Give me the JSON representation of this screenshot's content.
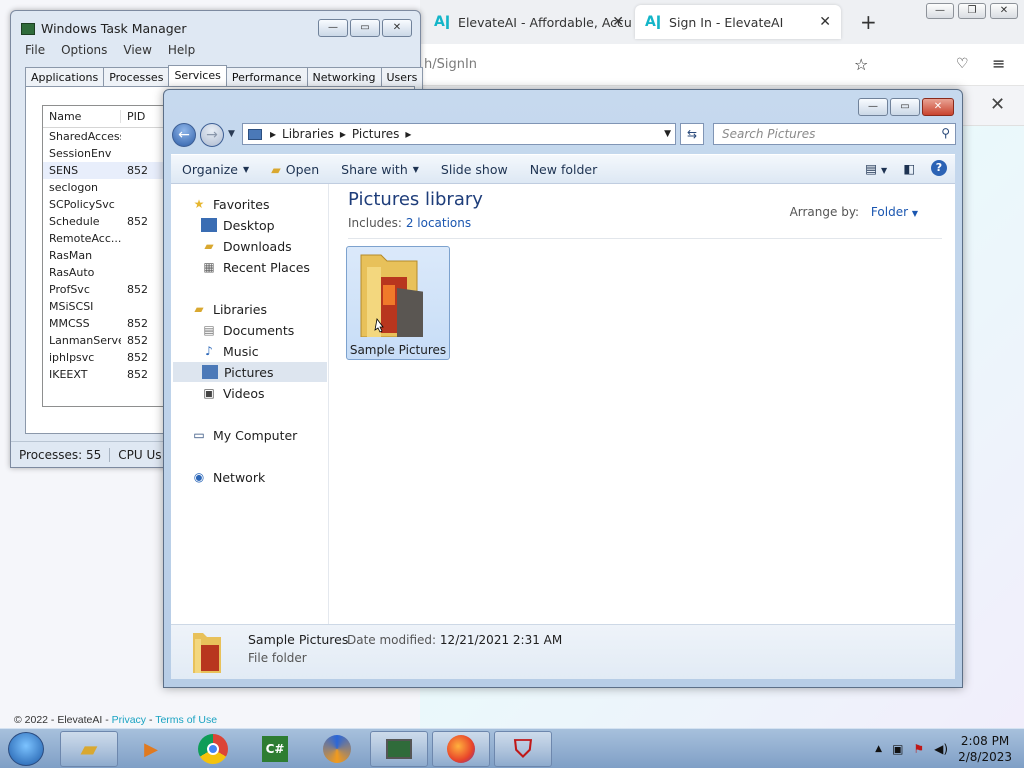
{
  "browser": {
    "tabs": [
      {
        "label": "ElevateAI - Affordable, Accu",
        "active": false
      },
      {
        "label": "Sign In - ElevateAI",
        "active": true
      }
    ],
    "new_tab": "+",
    "url_fragment": "h/SignIn",
    "footer": {
      "copyright": "© 2022 - ElevateAI - ",
      "privacy": "Privacy",
      "sep": " - ",
      "terms": "Terms of Use"
    }
  },
  "taskmgr": {
    "title": "Windows Task Manager",
    "menu": [
      "File",
      "Options",
      "View",
      "Help"
    ],
    "tabs": [
      "Applications",
      "Processes",
      "Services",
      "Performance",
      "Networking",
      "Users"
    ],
    "selected_tab": "Services",
    "columns": [
      "Name",
      "PID"
    ],
    "rows": [
      {
        "name": "SharedAccess",
        "pid": ""
      },
      {
        "name": "SessionEnv",
        "pid": ""
      },
      {
        "name": "SENS",
        "pid": "852"
      },
      {
        "name": "seclogon",
        "pid": ""
      },
      {
        "name": "SCPolicySvc",
        "pid": ""
      },
      {
        "name": "Schedule",
        "pid": "852"
      },
      {
        "name": "RemoteAcc...",
        "pid": ""
      },
      {
        "name": "RasMan",
        "pid": ""
      },
      {
        "name": "RasAuto",
        "pid": ""
      },
      {
        "name": "ProfSvc",
        "pid": "852"
      },
      {
        "name": "MSiSCSI",
        "pid": ""
      },
      {
        "name": "MMCSS",
        "pid": "852"
      },
      {
        "name": "LanmanServer",
        "pid": "852"
      },
      {
        "name": "iphlpsvc",
        "pid": "852"
      },
      {
        "name": "IKEEXT",
        "pid": "852"
      }
    ],
    "status": {
      "processes": "Processes: 55",
      "cpu": "CPU Us"
    }
  },
  "explorer": {
    "breadcrumb": [
      "Libraries",
      "Pictures"
    ],
    "search_placeholder": "Search Pictures",
    "commands": {
      "organize": "Organize",
      "open": "Open",
      "share": "Share with",
      "slideshow": "Slide show",
      "newfolder": "New folder"
    },
    "nav": {
      "favorites": "Favorites",
      "desktop": "Desktop",
      "downloads": "Downloads",
      "recent": "Recent Places",
      "libraries": "Libraries",
      "documents": "Documents",
      "music": "Music",
      "pictures": "Pictures",
      "videos": "Videos",
      "computer": "My Computer",
      "network": "Network"
    },
    "library_title": "Pictures library",
    "includes_label": "Includes:",
    "includes_link": "2 locations",
    "arrange_label": "Arrange by:",
    "arrange_value": "Folder",
    "items": [
      {
        "name": "Sample Pictures"
      }
    ],
    "details": {
      "name": "Sample Pictures",
      "modified_label": "Date modified:",
      "modified_value": "12/21/2021 2:31 AM",
      "type": "File folder"
    }
  },
  "taskbar": {
    "clock_time": "2:08 PM",
    "clock_date": "2/8/2023",
    "apps": [
      "explorer-icon",
      "media-player-icon",
      "chrome-icon",
      "csharp-icon",
      "browser-lock-icon",
      "task-manager-icon",
      "firefox-icon",
      "mcafee-icon"
    ]
  },
  "colors": {
    "accent": "#13b5c8",
    "link": "#1a56b0",
    "library_title": "#1e3d7a"
  }
}
